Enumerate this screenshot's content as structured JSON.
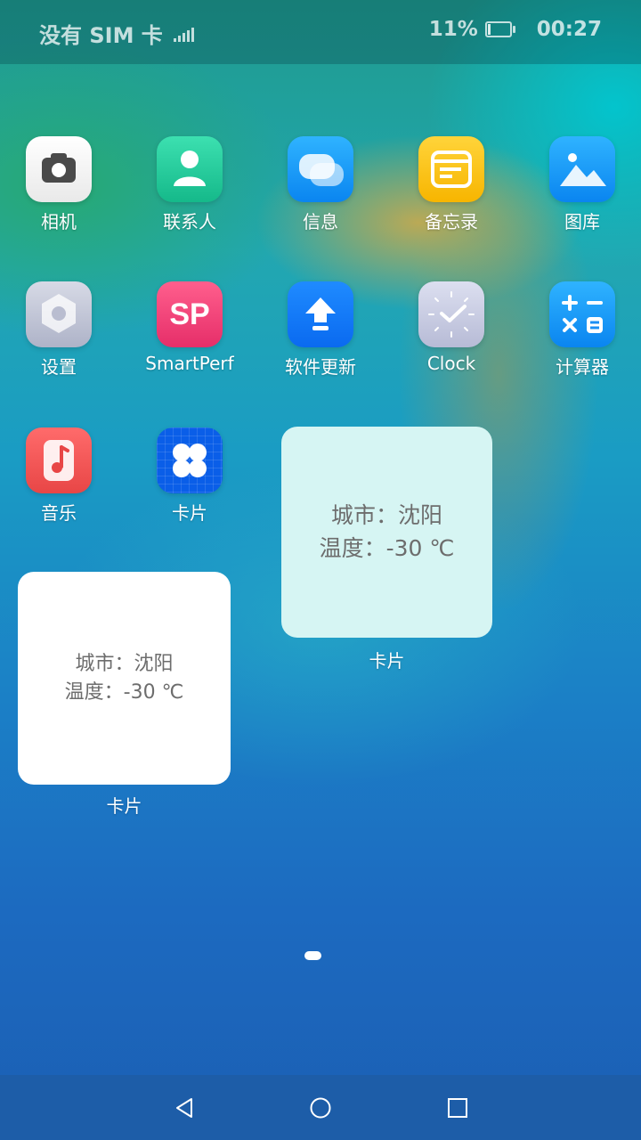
{
  "status_bar": {
    "carrier": "没有 SIM 卡",
    "battery": "11%",
    "time": "00:27"
  },
  "apps": [
    {
      "label": "相机",
      "icon": "camera-icon"
    },
    {
      "label": "联系人",
      "icon": "contacts-icon"
    },
    {
      "label": "信息",
      "icon": "messages-icon"
    },
    {
      "label": "备忘录",
      "icon": "notes-icon"
    },
    {
      "label": "图库",
      "icon": "gallery-icon"
    },
    {
      "label": "设置",
      "icon": "settings-icon"
    },
    {
      "label": "SmartPerf",
      "icon": "smartperf-icon",
      "icon_text": "SP"
    },
    {
      "label": "软件更新",
      "icon": "software-update-icon"
    },
    {
      "label": "Clock",
      "icon": "clock-icon"
    },
    {
      "label": "计算器",
      "icon": "calculator-icon"
    },
    {
      "label": "音乐",
      "icon": "music-icon"
    },
    {
      "label": "卡片",
      "icon": "cards-icon"
    }
  ],
  "widgets": [
    {
      "city": "城市：沈阳",
      "temperature": "温度：-30 ℃",
      "caption": "卡片"
    },
    {
      "city": "城市：沈阳",
      "temperature": "温度：-30 ℃",
      "caption": "卡片"
    }
  ],
  "colors": {
    "nav_bar": "#1d5da8",
    "widget_tint": "#d6f5f3",
    "widget_white": "#ffffff"
  }
}
